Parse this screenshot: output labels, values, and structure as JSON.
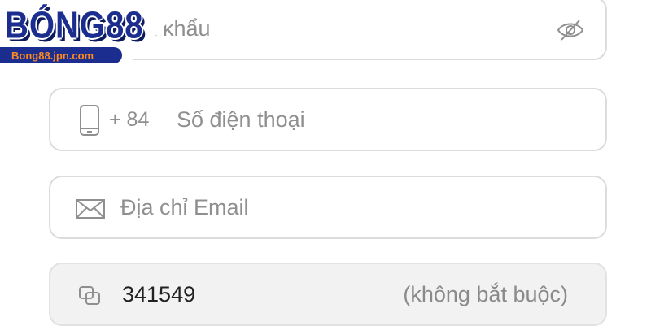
{
  "brand": {
    "logo_text": "BÓNG88",
    "logo_url": "Bong88.jpn.com"
  },
  "form": {
    "password_placeholder": "ật khẩu",
    "phone_prefix": "+ 84",
    "phone_placeholder": "Số điện thoại",
    "email_placeholder": "Địa chỉ Email",
    "referral_value": "341549",
    "referral_optional": "(không bắt buộc)"
  },
  "colors": {
    "border": "#dcdcdc",
    "placeholder": "#8f8f8f",
    "logo_blue": "#1b2e8f",
    "logo_orange": "#ff8a1f"
  },
  "icons": {
    "password_toggle": "eye-off-icon",
    "phone": "phone-icon",
    "email": "mail-icon",
    "referral": "copy-icon"
  }
}
